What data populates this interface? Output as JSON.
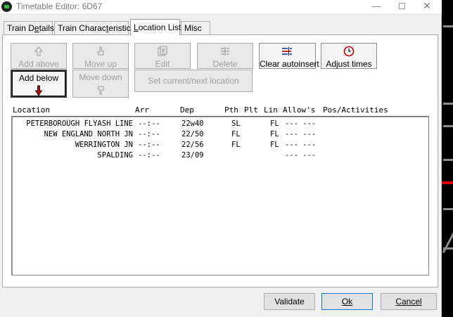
{
  "window": {
    "title": "Timetable Editor: 6D67"
  },
  "tabs": [
    {
      "label": "Train Details",
      "underline_index": 7
    },
    {
      "label": "Train Characteristics",
      "underline_index": 12
    },
    {
      "label": "Location List",
      "underline_index": 0
    },
    {
      "label": "Misc",
      "underline_index": -1
    }
  ],
  "active_tab": "Location List",
  "toolbar": {
    "add_above": "Add above",
    "add_below": "Add below",
    "move_up": "Move up",
    "move_down": "Move down",
    "edit": "Edit",
    "delete": "Delete",
    "set_current_next": "Set current/next location",
    "clear_autoinsert": "Clear autoinsert",
    "adjust_times": "Adjust times"
  },
  "columns": [
    "Location",
    "Arr",
    "Dep",
    "Pth",
    "Plt",
    "Lin",
    "Allow's",
    "Pos/Activities"
  ],
  "rows": [
    {
      "location": "PETERBOROUGH FLYASH LINE",
      "arr": "--:--",
      "dep": "22w40",
      "pth": "SL",
      "plt": "",
      "lin": "FL",
      "allow": "--- ---",
      "pos": ""
    },
    {
      "location": "NEW ENGLAND NORTH JN",
      "arr": "--:--",
      "dep": "22/50",
      "pth": "FL",
      "plt": "",
      "lin": "FL",
      "allow": "--- ---",
      "pos": ""
    },
    {
      "location": "WERRINGTON JN",
      "arr": "--:--",
      "dep": "22/56",
      "pth": "FL",
      "plt": "",
      "lin": "FL",
      "allow": "--- ---",
      "pos": ""
    },
    {
      "location": "SPALDING",
      "arr": "--:--",
      "dep": "23/09",
      "pth": "",
      "plt": "",
      "lin": "",
      "allow": "--- ---",
      "pos": ""
    }
  ],
  "buttons": {
    "validate": "Validate",
    "ok": "Ok",
    "cancel": "Cancel"
  },
  "colors": {
    "accent": "#0078d7",
    "arrow_red": "#c00000"
  }
}
